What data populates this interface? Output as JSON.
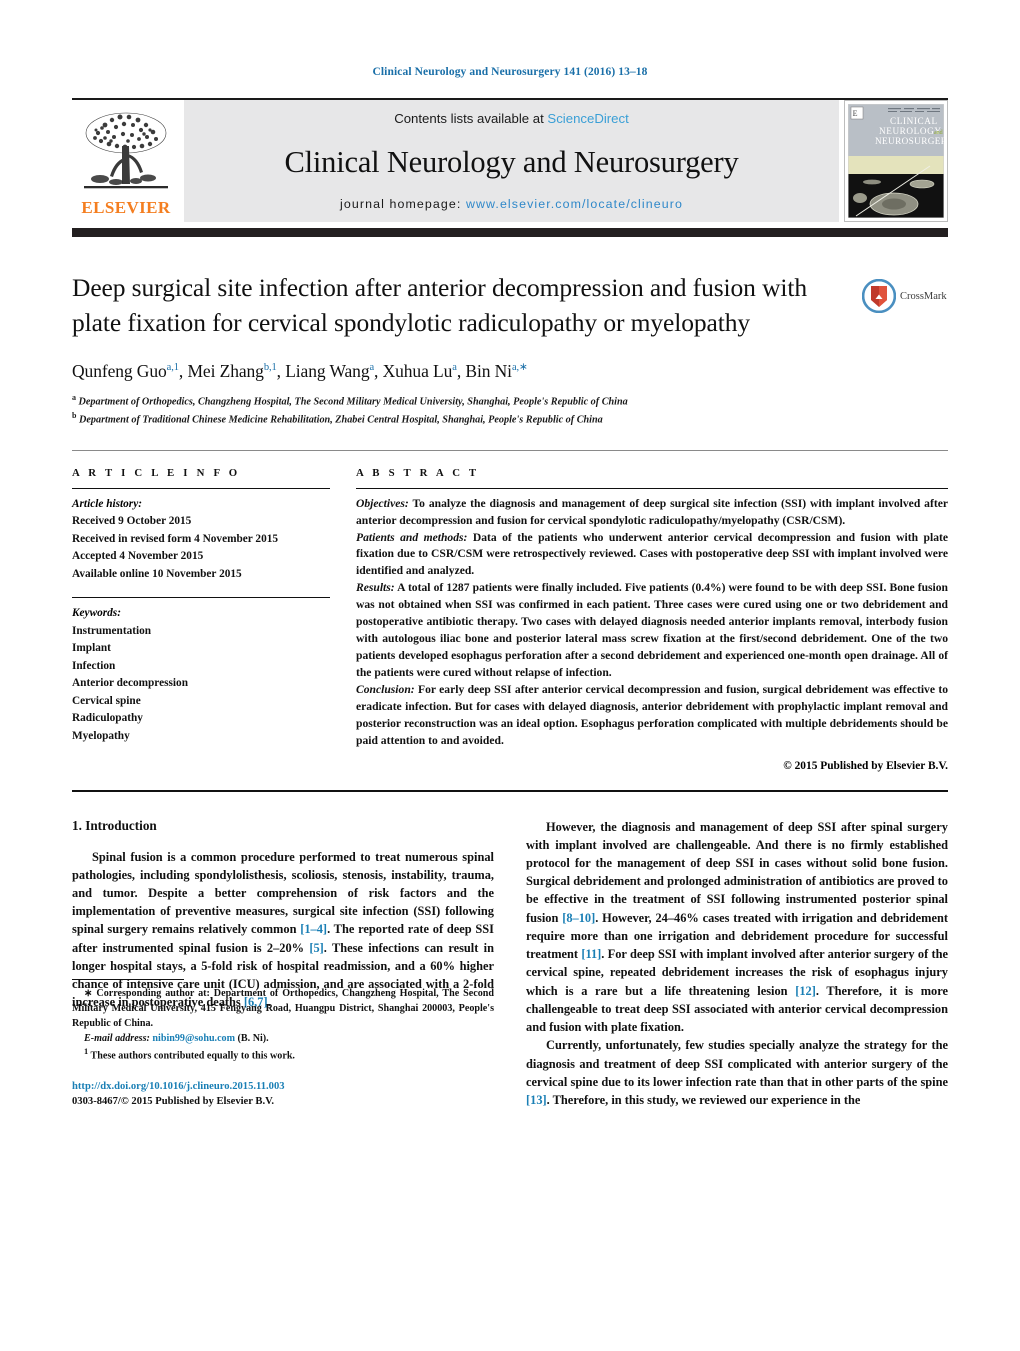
{
  "running_head": "Clinical Neurology and Neurosurgery 141 (2016) 13–18",
  "masthead": {
    "publisher_logo_text": "ELSEVIER",
    "contents_prefix": "Contents lists available at",
    "contents_link": "ScienceDirect",
    "journal_name": "Clinical Neurology and Neurosurgery",
    "homepage_prefix": "journal homepage:",
    "homepage_url": "www.elsevier.com/locate/clineuro",
    "cover_title_lines": [
      "CLINICAL",
      "NEUROLOGY and",
      "NEUROSURGERY"
    ]
  },
  "article": {
    "title": "Deep surgical site infection after anterior decompression and fusion with plate fixation for cervical spondylotic radiculopathy or myelopathy",
    "crossmark_label": "CrossMark",
    "authors_html": "Qunfeng Guo<sup>a,1</sup>, Mei Zhang<sup>b,1</sup>, Liang Wang<sup>a</sup>, Xuhua Lu<sup>a</sup>, Bin Ni<sup>a,∗</sup>",
    "affiliations": [
      {
        "mark": "a",
        "text": "Department of Orthopedics, Changzheng Hospital, The Second Military Medical University, Shanghai, People's Republic of China"
      },
      {
        "mark": "b",
        "text": "Department of Traditional Chinese Medicine Rehabilitation, Zhabei Central Hospital, Shanghai, People's Republic of China"
      }
    ]
  },
  "article_info": {
    "heading": "A R T I C L E   I N F O",
    "history_label": "Article history:",
    "history": [
      "Received 9 October 2015",
      "Received in revised form 4 November 2015",
      "Accepted 4 November 2015",
      "Available online 10 November 2015"
    ],
    "keywords_label": "Keywords:",
    "keywords": [
      "Instrumentation",
      "Implant",
      "Infection",
      "Anterior decompression",
      "Cervical spine",
      "Radiculopathy",
      "Myelopathy"
    ]
  },
  "abstract": {
    "heading": "A B S T R A C T",
    "sections": [
      {
        "label": "Objectives:",
        "text": " To analyze the diagnosis and management of deep surgical site infection (SSI) with implant involved after anterior decompression and fusion for cervical spondylotic radiculopathy/myelopathy (CSR/CSM)."
      },
      {
        "label": "Patients and methods:",
        "text": " Data of the patients who underwent anterior cervical decompression and fusion with plate fixation due to CSR/CSM were retrospectively reviewed. Cases with postoperative deep SSI with implant involved were identified and analyzed."
      },
      {
        "label": "Results:",
        "text": " A total of 1287 patients were finally included. Five patients (0.4%) were found to be with deep SSI. Bone fusion was not obtained when SSI was confirmed in each patient. Three cases were cured using one or two debridement and postoperative antibiotic therapy. Two cases with delayed diagnosis needed anterior implants removal, interbody fusion with autologous iliac bone and posterior lateral mass screw fixation at the first/second debridement. One of the two patients developed esophagus perforation after a second debridement and experienced one-month open drainage. All of the patients were cured without relapse of infection."
      },
      {
        "label": "Conclusion:",
        "text": " For early deep SSI after anterior cervical decompression and fusion, surgical debridement was effective to eradicate infection. But for cases with delayed diagnosis, anterior debridement with prophylactic implant removal and posterior reconstruction was an ideal option. Esophagus perforation complicated with multiple debridements should be paid attention to and avoided."
      }
    ],
    "copyright": "© 2015 Published by Elsevier B.V."
  },
  "body": {
    "section_number_title": "1.  Introduction",
    "left_paragraphs": [
      {
        "runs": [
          {
            "t": "Spinal fusion is a common procedure performed to treat numerous spinal pathologies, including spondylolisthesis, scoliosis, stenosis, instability, trauma, and tumor. Despite a better comprehension of risk factors and the implementation of preventive measures, surgical site infection (SSI) following spinal surgery remains relatively common "
          },
          {
            "t": "[1–4]",
            "ref": true
          },
          {
            "t": ". The reported rate of deep SSI after instrumented spinal fusion is 2–20% "
          },
          {
            "t": "[5]",
            "ref": true
          },
          {
            "t": ". These infections can result in longer hospital stays, a 5-fold risk of hospital readmission, and a 60% higher chance of intensive care unit (ICU) admission, and are associated with a 2-fold increase in postoperative deaths "
          },
          {
            "t": "[6,7]",
            "ref": true
          },
          {
            "t": "."
          }
        ]
      }
    ],
    "right_paragraphs": [
      {
        "runs": [
          {
            "t": "However, the diagnosis and management of deep SSI after spinal surgery with implant involved are challengeable. And there is no firmly established protocol for the management of deep SSI in cases without solid bone fusion. Surgical debridement and prolonged administration of antibiotics are proved to be effective in the treatment of SSI following instrumented posterior spinal fusion "
          },
          {
            "t": "[8–10]",
            "ref": true
          },
          {
            "t": ". However, 24–46% cases treated with irrigation and debridement require more than one irrigation and debridement procedure for successful treatment "
          },
          {
            "t": "[11]",
            "ref": true
          },
          {
            "t": ". For deep SSI with implant involved after anterior surgery of the cervical spine, repeated debridement increases the risk of esophagus injury which is a rare but a life threatening lesion "
          },
          {
            "t": "[12]",
            "ref": true
          },
          {
            "t": ". Therefore, it is more challengeable to treat deep SSI associated with anterior cervical decompression and fusion with plate fixation."
          }
        ]
      },
      {
        "runs": [
          {
            "t": "Currently, unfortunately, few studies specially analyze the strategy for the diagnosis and treatment of deep SSI complicated with anterior surgery of the cervical spine due to its lower infection rate than that in other parts of the spine "
          },
          {
            "t": "[13]",
            "ref": true
          },
          {
            "t": ". Therefore, in this study, we reviewed our experience in the"
          }
        ]
      }
    ]
  },
  "footnotes": {
    "corresponding_marker": "∗",
    "corresponding_text": "Corresponding author at: Department of Orthopedics, Changzheng Hospital, The Second Military Medical University, 415 Fengyang Road, Huangpu District, Shanghai 200003, People's Republic of China.",
    "email_label": "E-mail address:",
    "email": "nibin99@sohu.com",
    "email_suffix": "(B. Ni).",
    "equal_marker": "1",
    "equal_text": "These authors contributed equally to this work.",
    "doi": "http://dx.doi.org/10.1016/j.clineuro.2015.11.003",
    "issn_line": "0303-8467/© 2015 Published by Elsevier B.V."
  },
  "colors": {
    "link": "#1a7fb5",
    "running_head": "#1a6fa8",
    "elsevier_orange": "#F47E20",
    "band_gray": "#e7e7e8",
    "rule_black": "#231f20"
  }
}
